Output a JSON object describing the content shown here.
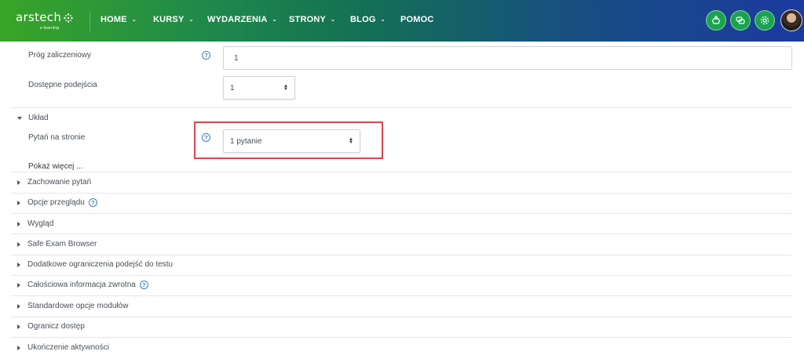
{
  "brand": {
    "name": "arstech",
    "tagline": "e-learning"
  },
  "nav": {
    "items": [
      {
        "label": "HOME",
        "dropdown": true
      },
      {
        "label": "KURSY",
        "dropdown": true
      },
      {
        "label": "WYDARZENIA",
        "dropdown": true
      },
      {
        "label": "STRONY",
        "dropdown": true
      },
      {
        "label": "BLOG",
        "dropdown": true
      },
      {
        "label": "POMOC",
        "dropdown": false
      }
    ],
    "icons": [
      "robot-icon",
      "chat-icon",
      "settings-gear-icon"
    ],
    "colors": {
      "gradient_start": "#39a527",
      "gradient_end": "#1b3aa0",
      "button": "#1aa34e"
    }
  },
  "form": {
    "pass_grade": {
      "label": "Próg zaliczeniowy",
      "value": "1"
    },
    "attempts": {
      "label": "Dostępne podejścia",
      "value": "1"
    },
    "layout_section": "Układ",
    "questions_per_page": {
      "label": "Pytań na stronie",
      "value": "1 pytanie"
    },
    "show_more": "Pokaż więcej ...",
    "sections": [
      {
        "label": "Zachowanie pytań",
        "help": false
      },
      {
        "label": "Opcje przeglądu",
        "help": true
      },
      {
        "label": "Wygląd",
        "help": false
      },
      {
        "label": "Safe Exam Browser",
        "help": false
      },
      {
        "label": "Dodatkowe ograniczenia podejść do testu",
        "help": false
      },
      {
        "label": "Całościowa informacja zwrotna",
        "help": true
      },
      {
        "label": "Standardowe opcje modułów",
        "help": false
      },
      {
        "label": "Ogranicz dostęp",
        "help": false
      },
      {
        "label": "Ukończenie aktywności",
        "help": false
      }
    ],
    "help_glyph": "?",
    "highlight_color": "#d9474b"
  }
}
